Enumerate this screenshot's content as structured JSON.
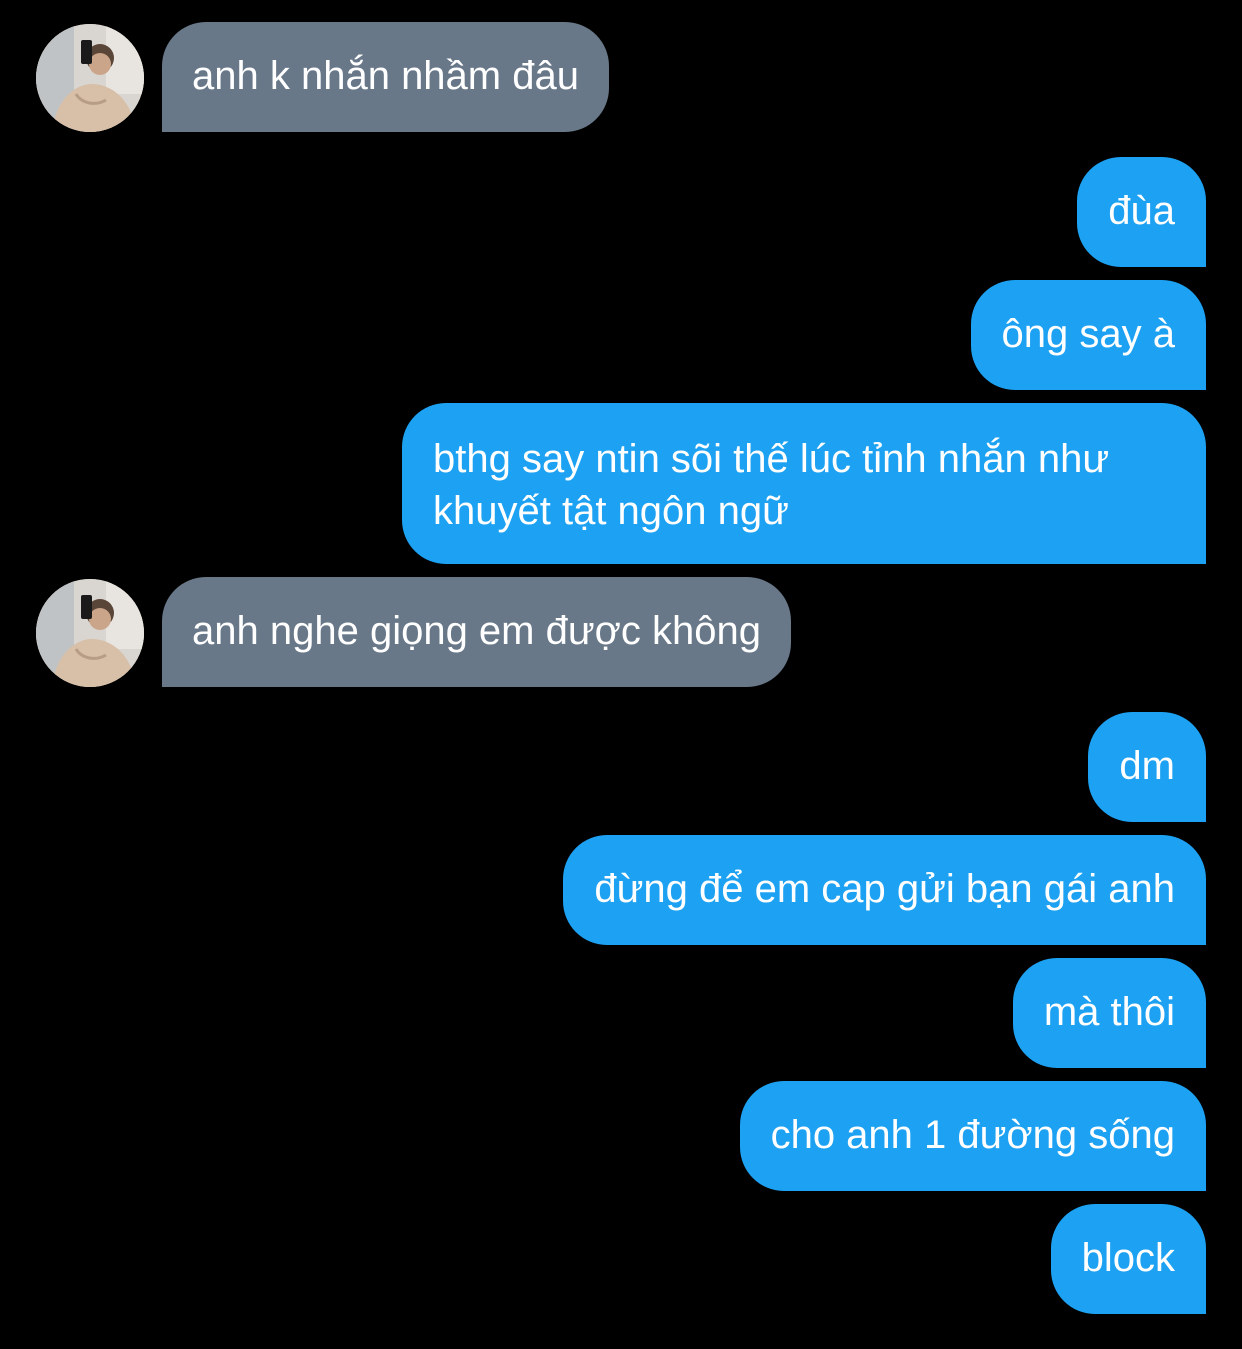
{
  "conversation": {
    "theme": {
      "background": "#000000",
      "incoming_bubble": "#687889",
      "outgoing_bubble": "#1da1f2",
      "text": "#ffffff"
    },
    "messages": [
      {
        "direction": "incoming",
        "text": "anh k nhắn nhầm đâu"
      },
      {
        "direction": "outgoing",
        "text": "đùa"
      },
      {
        "direction": "outgoing",
        "text": "ông say à"
      },
      {
        "direction": "outgoing",
        "text": "bthg say ntin sõi thế lúc tỉnh nhắn như khuyết tật ngôn ngữ"
      },
      {
        "direction": "incoming",
        "text": "anh nghe giọng em được không"
      },
      {
        "direction": "outgoing",
        "text": "dm"
      },
      {
        "direction": "outgoing",
        "text": "đừng để em cap gửi bạn gái anh"
      },
      {
        "direction": "outgoing",
        "text": "mà thôi"
      },
      {
        "direction": "outgoing",
        "text": "cho anh 1 đường sống"
      },
      {
        "direction": "outgoing",
        "text": "block"
      }
    ]
  }
}
